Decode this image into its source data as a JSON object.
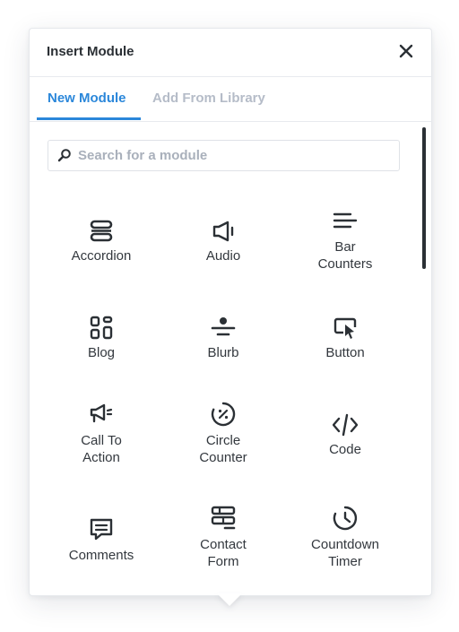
{
  "header": {
    "title": "Insert Module",
    "close_icon": "close-icon"
  },
  "tabs": [
    {
      "label": "New Module",
      "active": true
    },
    {
      "label": "Add From Library",
      "active": false
    }
  ],
  "search": {
    "placeholder": "Search for a module",
    "value": "",
    "icon": "search-icon"
  },
  "colors": {
    "accent": "#2b87da",
    "text": "#33383e",
    "muted": "#b5bcc8"
  },
  "modules": [
    {
      "label": "Accordion",
      "icon": "accordion-icon"
    },
    {
      "label": "Audio",
      "icon": "audio-icon"
    },
    {
      "label": "Bar\nCounters",
      "icon": "bar-counters-icon"
    },
    {
      "label": "Blog",
      "icon": "blog-icon"
    },
    {
      "label": "Blurb",
      "icon": "blurb-icon"
    },
    {
      "label": "Button",
      "icon": "button-icon"
    },
    {
      "label": "Call To\nAction",
      "icon": "call-to-action-icon"
    },
    {
      "label": "Circle\nCounter",
      "icon": "circle-counter-icon"
    },
    {
      "label": "Code",
      "icon": "code-icon"
    },
    {
      "label": "Comments",
      "icon": "comments-icon"
    },
    {
      "label": "Contact\nForm",
      "icon": "contact-form-icon"
    },
    {
      "label": "Countdown\nTimer",
      "icon": "countdown-timer-icon"
    }
  ]
}
